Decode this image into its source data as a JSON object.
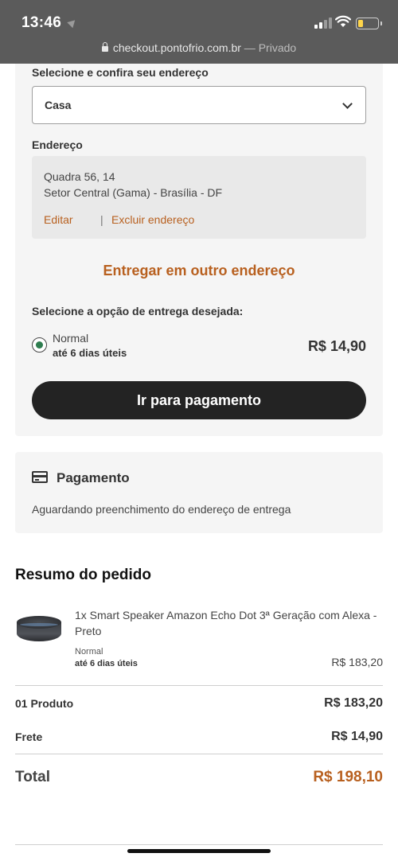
{
  "status_bar": {
    "time": "13:46"
  },
  "browser": {
    "url": "checkout.pontofrio.com.br",
    "separator": " — ",
    "mode": "Privado"
  },
  "address": {
    "select_label": "Selecione e confira seu endereço",
    "selected": "Casa",
    "section_label": "Endereço",
    "line1": "Quadra 56, 14",
    "line2": "Setor Central (Gama) - Brasília - DF",
    "edit_link": "Editar",
    "separator": "|",
    "delete_link": "Excluir endereço",
    "other_address": "Entregar em outro endereço"
  },
  "delivery": {
    "label": "Selecione a opção de entrega desejada:",
    "option_name": "Normal",
    "option_days": "até 6 dias úteis",
    "option_price": "R$ 14,90",
    "selected": true
  },
  "pay_button": "Ir para pagamento",
  "payment": {
    "icon": "credit-card-icon",
    "title": "Pagamento",
    "message": "Aguardando preenchimento do endereço de entrega"
  },
  "summary": {
    "title": "Resumo do pedido",
    "product": {
      "name": "1x Smart Speaker Amazon Echo Dot 3ª Geração com Alexa - Preto",
      "shipping": "Normal",
      "days": "até 6 dias úteis",
      "price": "R$ 183,20"
    },
    "products_label": "01 Produto",
    "products_value": "R$ 183,20",
    "freight_label": "Frete",
    "freight_value": "R$ 14,90",
    "total_label": "Total",
    "total_value": "R$ 198,10"
  },
  "colors": {
    "accent": "#b8601f",
    "button": "#232323",
    "radio": "#2e7d4f",
    "card_bg": "#f5f5f5"
  }
}
